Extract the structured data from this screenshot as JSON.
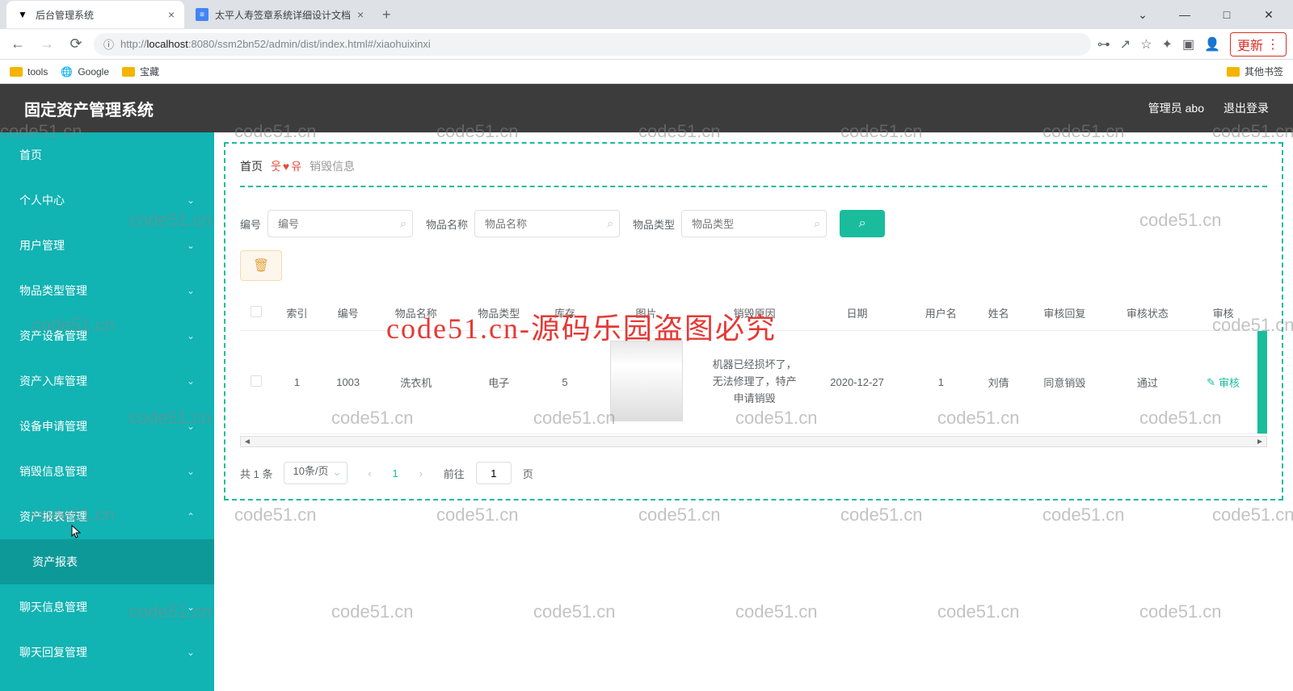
{
  "browser": {
    "tabs": [
      {
        "title": "后台管理系统",
        "active": true
      },
      {
        "title": "太平人寿签章系统详细设计文档",
        "active": false
      }
    ],
    "url_prefix": "http://",
    "url_host": "localhost",
    "url_port": ":8080",
    "url_path": "/ssm2bn52/admin/dist/index.html#/xiaohuixinxi",
    "update_label": "更新",
    "bookmarks": [
      {
        "label": "tools"
      },
      {
        "label": "Google"
      },
      {
        "label": "宝藏"
      }
    ],
    "other_bookmarks": "其他书签"
  },
  "header": {
    "app_title": "固定资产管理系统",
    "user_label": "管理员 abo",
    "logout": "退出登录"
  },
  "sidebar": {
    "items": [
      {
        "label": "首页",
        "expandable": false
      },
      {
        "label": "个人中心",
        "expandable": true
      },
      {
        "label": "用户管理",
        "expandable": true
      },
      {
        "label": "物品类型管理",
        "expandable": true
      },
      {
        "label": "资产设备管理",
        "expandable": true
      },
      {
        "label": "资产入库管理",
        "expandable": true
      },
      {
        "label": "设备申请管理",
        "expandable": true
      },
      {
        "label": "销毁信息管理",
        "expandable": true
      },
      {
        "label": "资产报表管理",
        "expandable": true,
        "expanded": true
      },
      {
        "label": "资产报表",
        "sub": true
      },
      {
        "label": "聊天信息管理",
        "expandable": true
      },
      {
        "label": "聊天回复管理",
        "expandable": true
      }
    ]
  },
  "breadcrumb": {
    "home": "首页",
    "current": "销毁信息"
  },
  "search": {
    "fields": [
      {
        "label": "编号",
        "placeholder": "编号"
      },
      {
        "label": "物品名称",
        "placeholder": "物品名称"
      },
      {
        "label": "物品类型",
        "placeholder": "物品类型"
      }
    ]
  },
  "table": {
    "columns": [
      "",
      "索引",
      "编号",
      "物品名称",
      "物品类型",
      "库存",
      "图片",
      "销毁原因",
      "日期",
      "用户名",
      "姓名",
      "审核回复",
      "审核状态",
      "审核"
    ],
    "rows": [
      {
        "index": "1",
        "code": "1003",
        "name": "洗衣机",
        "type": "电子",
        "stock": "5",
        "reason": "机器已经损坏了，无法修理了，特产申请销毁",
        "date": "2020-12-27",
        "username": "1",
        "realname": "刘倩",
        "reply": "同意销毁",
        "status": "通过",
        "audit": "审核"
      }
    ]
  },
  "pagination": {
    "total": "共 1 条",
    "page_size": "10条/页",
    "current": "1",
    "goto_prefix": "前往",
    "goto_value": "1",
    "goto_suffix": "页"
  },
  "watermark_text": "code51.cn",
  "big_watermark": "code51.cn-源码乐园盗图必究"
}
